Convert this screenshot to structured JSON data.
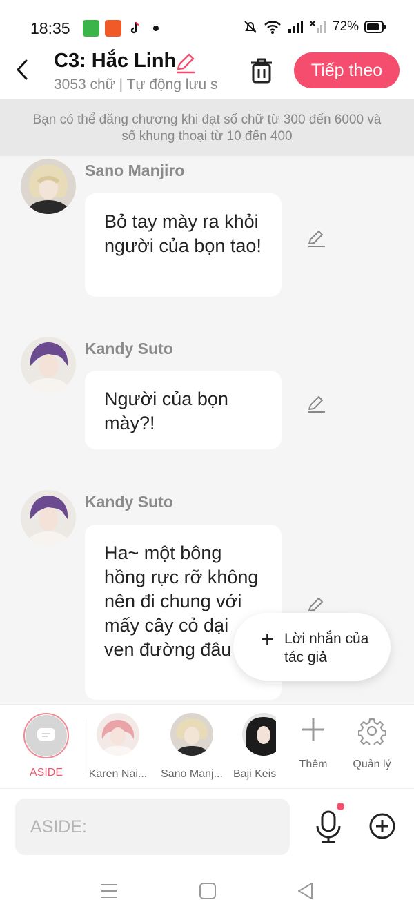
{
  "status_bar": {
    "time": "18:35",
    "battery": "72%"
  },
  "header": {
    "title": "C3: Hắc Linh",
    "subtitle": "3053 chữ | Tự động lưu s",
    "next_button": "Tiếp theo"
  },
  "notice": "Bạn có thể đăng chương khi đạt số chữ từ 300 đến 6000 và số khung thoại từ 10 đến 400",
  "messages": [
    {
      "speaker": "Sano Manjiro",
      "text": "Bỏ tay mày ra khỏi người của bọn tao!"
    },
    {
      "speaker": "Kandy Suto",
      "text": "Người của bọn mày?!"
    },
    {
      "speaker": "Kandy Suto",
      "text": "Ha~ một bông hồng rực rỡ không nên đi chung với mấy cây cỏ dại ven đường đâu"
    }
  ],
  "popup": {
    "label": "Lời nhắn của tác giả"
  },
  "characters": {
    "aside": "ASIDE",
    "items": [
      "Karen Nai...",
      "Sano Manj...",
      "Baji Keis"
    ],
    "add": "Thêm",
    "manage": "Quản lý"
  },
  "input": {
    "placeholder": "ASIDE:"
  },
  "colors": {
    "accent": "#f54d6d",
    "chat_bg": "#f5f5f5",
    "notice_bg": "#e8e8e8"
  }
}
